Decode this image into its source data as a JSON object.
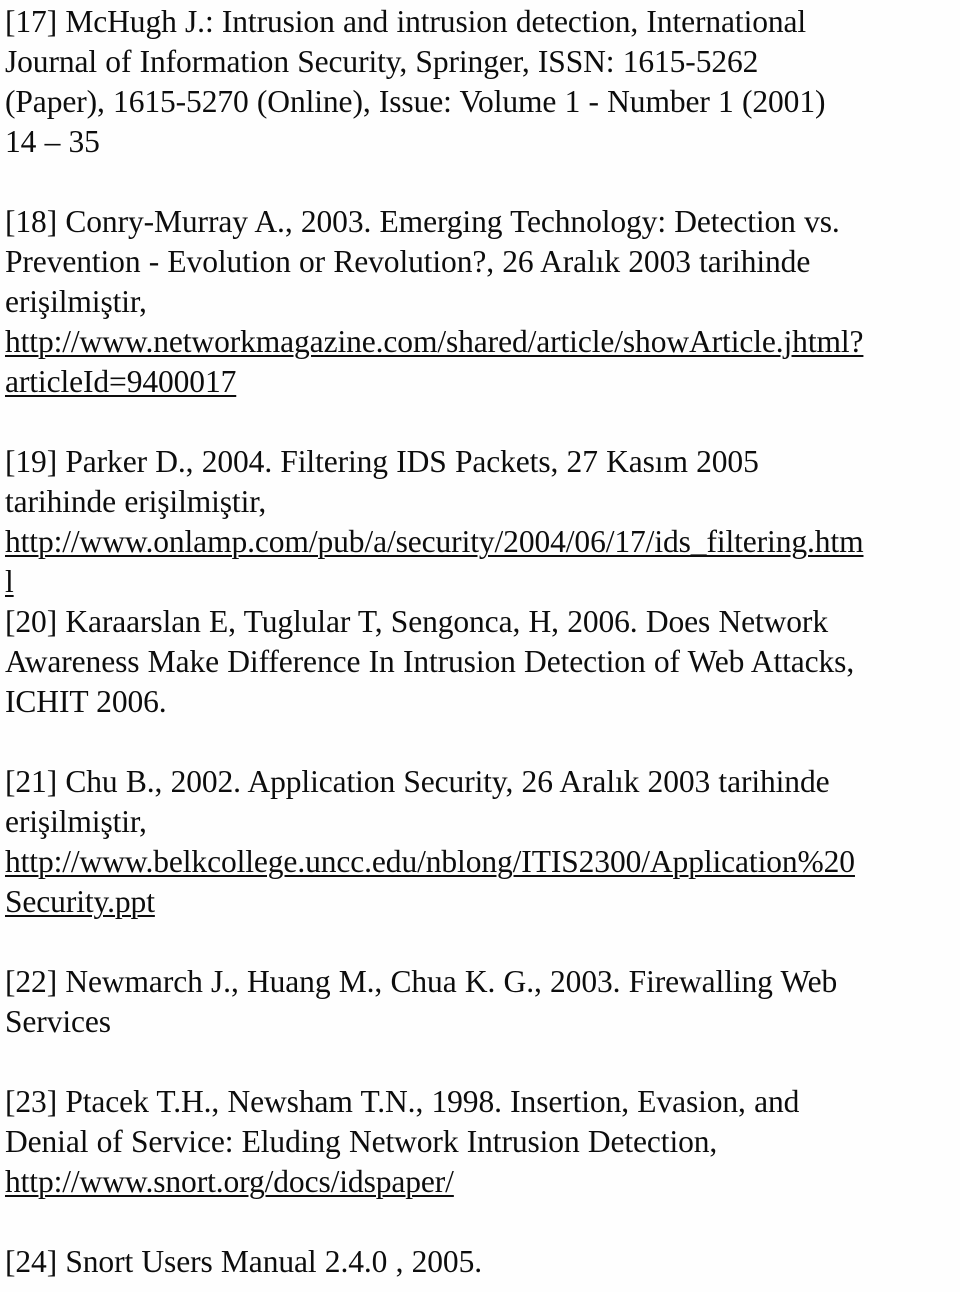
{
  "document": {
    "type": "bibliography-page",
    "language": "Turkish/English",
    "background_color": "#fefefe",
    "text_color": "#0d0d0d"
  },
  "references": [
    {
      "id": "ref-17",
      "marker": "[17]",
      "lines": [
        "[17] McHugh J.: Intrusion and intrusion detection, International",
        "Journal of Information Security, Springer, ISSN: 1615-5262",
        "(Paper), 1615-5270 (Online), Issue: Volume 1 - Number 1 (2001)",
        "14 – 35"
      ],
      "url_lines": [],
      "gap_after": true
    },
    {
      "id": "ref-18",
      "marker": "[18]",
      "lines": [
        "[18] Conry-Murray A., 2003. Emerging Technology: Detection vs.",
        "Prevention - Evolution or Revolution?, 26 Aralık 2003 tarihinde",
        "erişilmiştir,"
      ],
      "url_lines": [
        "http://www.networkmagazine.com/shared/article/showArticle.jhtml?",
        "articleId=9400017"
      ],
      "gap_after": true
    },
    {
      "id": "ref-19",
      "marker": "[19]",
      "lines": [
        "[19] Parker D., 2004. Filtering IDS Packets, 27 Kasım 2005",
        "tarihinde erişilmiştir,"
      ],
      "url_lines": [
        "http://www.onlamp.com/pub/a/security/2004/06/17/ids_filtering.htm",
        "l"
      ],
      "gap_after": false
    },
    {
      "id": "ref-20",
      "marker": "[20]",
      "lines": [
        "[20] Karaarslan E, Tuglular T, Sengonca, H, 2006. Does Network",
        "Awareness Make Difference In Intrusion Detection of Web Attacks,",
        "ICHIT 2006."
      ],
      "url_lines": [],
      "gap_after": true
    },
    {
      "id": "ref-21",
      "marker": "[21]",
      "lines": [
        "[21] Chu B., 2002. Application Security, 26 Aralık 2003 tarihinde",
        "erişilmiştir,"
      ],
      "url_lines": [
        "http://www.belkcollege.uncc.edu/nblong/ITIS2300/Application%20",
        "Security.ppt"
      ],
      "gap_after": true
    },
    {
      "id": "ref-22",
      "marker": "[22]",
      "lines": [
        "[22] Newmarch J., Huang M., Chua K. G., 2003. Firewalling Web",
        "Services"
      ],
      "url_lines": [],
      "gap_after": true
    },
    {
      "id": "ref-23",
      "marker": "[23]",
      "lines": [
        "[23] Ptacek T.H., Newsham T.N., 1998. Insertion, Evasion, and",
        "Denial of Service: Eluding Network Intrusion Detection,"
      ],
      "url_lines": [
        "http://www.snort.org/docs/idspaper/"
      ],
      "gap_after": true
    },
    {
      "id": "ref-24",
      "marker": "[24]",
      "lines": [
        "[24] Snort Users Manual 2.4.0 , 2005."
      ],
      "url_lines": [],
      "gap_after": false
    }
  ]
}
